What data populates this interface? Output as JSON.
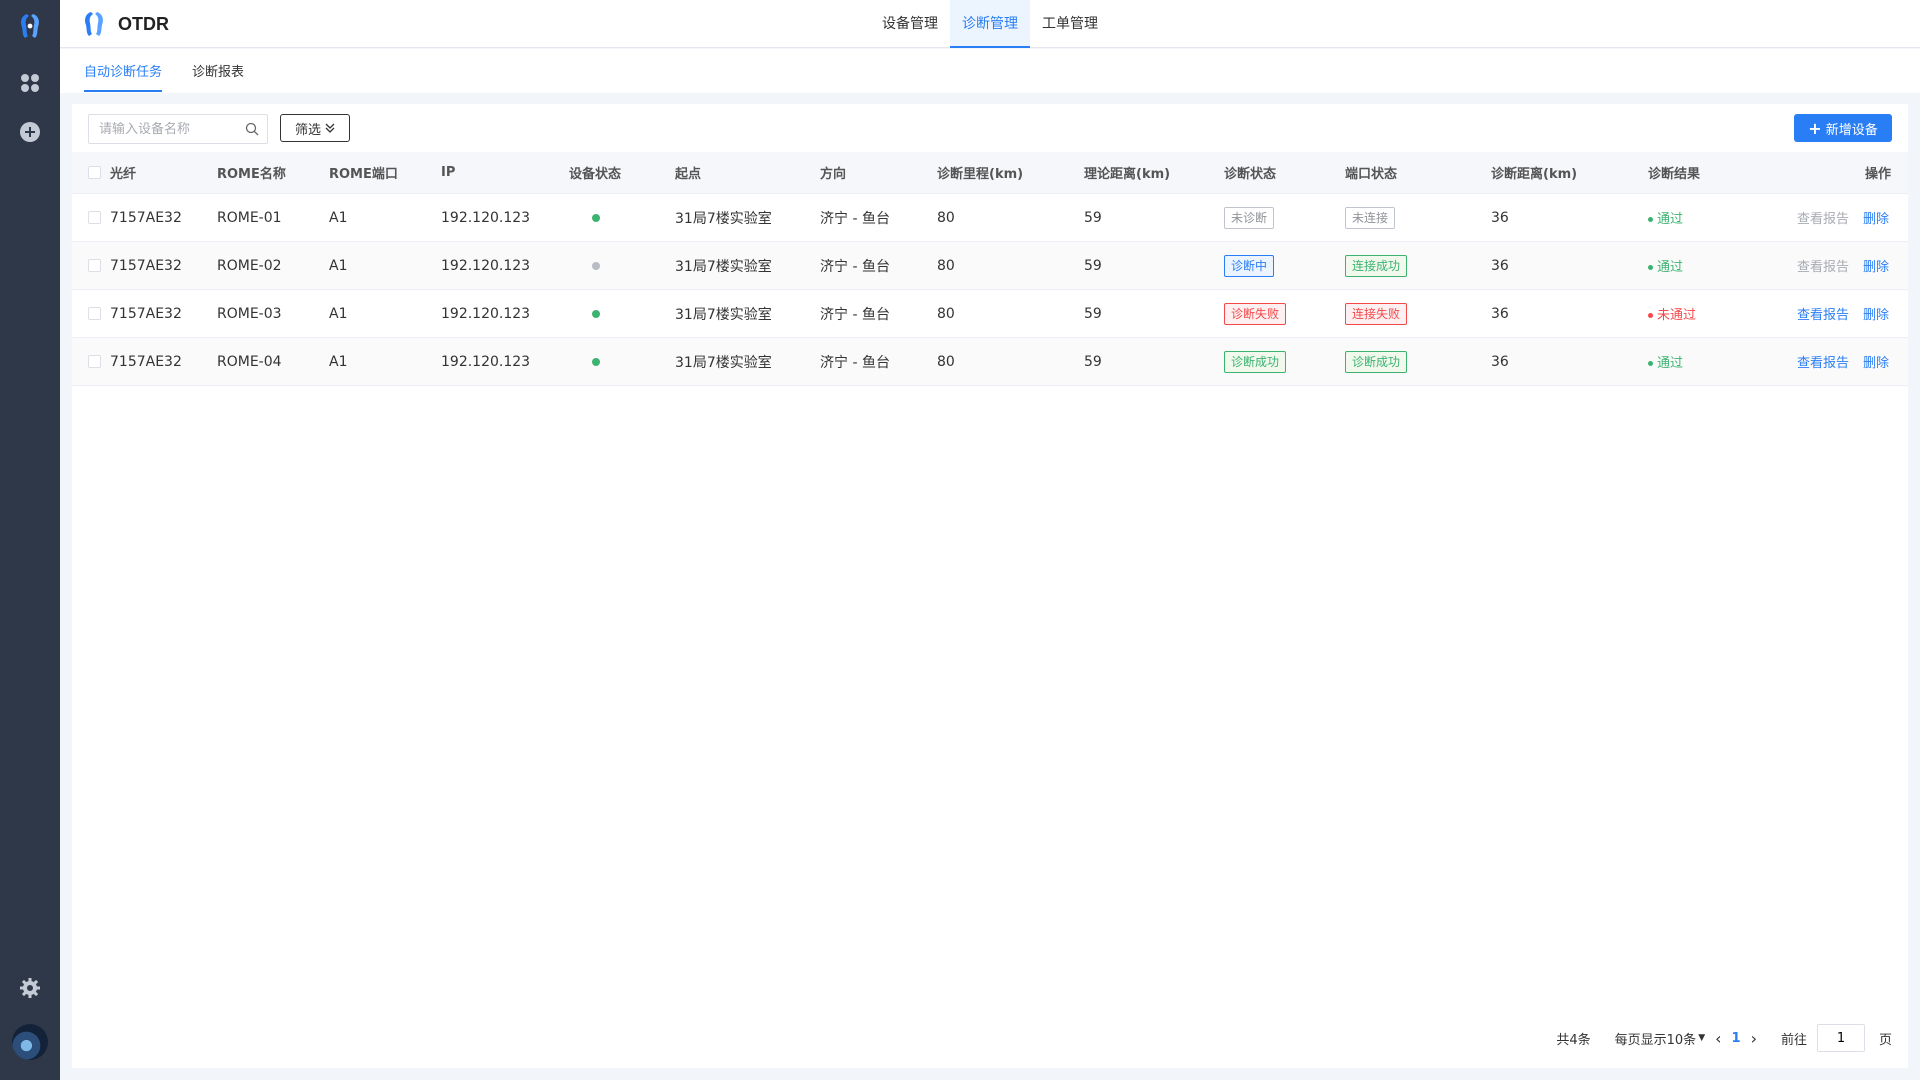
{
  "app": {
    "name": "OTDR",
    "brand_color": "#2a7ef5"
  },
  "rail": {
    "icons": [
      "logo-icon",
      "apps-grid-icon",
      "add-circle-icon",
      "settings-gear-icon",
      "user-avatar"
    ]
  },
  "top_tabs": [
    {
      "label": "设备管理",
      "active": false
    },
    {
      "label": "诊断管理",
      "active": true
    },
    {
      "label": "工单管理",
      "active": false
    }
  ],
  "sub_tabs": [
    {
      "label": "自动诊断任务",
      "active": true
    },
    {
      "label": "诊断报表",
      "active": false
    }
  ],
  "toolbar": {
    "search_placeholder": "请输入设备名称",
    "filter_label": "筛选",
    "add_label": "新增设备"
  },
  "table": {
    "columns": [
      "光纤",
      "ROME名称",
      "ROME端口",
      "IP",
      "设备状态",
      "起点",
      "方向",
      "诊断里程(km)",
      "理论距离(km)",
      "诊断状态",
      "端口状态",
      "诊断距离(km)",
      "诊断结果",
      "操作"
    ],
    "rows": [
      {
        "fiber": "7157AE32",
        "rome": "ROME-01",
        "port": "A1",
        "ip": "192.120.123",
        "device_status": "online",
        "start": "31局7楼实验室",
        "direction": "济宁 - 鱼台",
        "mileage": "80",
        "theory": "59",
        "diag_status": "未诊断",
        "diag_tag": "gray",
        "port_status": "未连接",
        "port_tag": "gray",
        "diag_dist": "36",
        "result": "通过",
        "result_type": "pass",
        "view": "查看报告",
        "view_enabled": false,
        "del": "删除"
      },
      {
        "fiber": "7157AE32",
        "rome": "ROME-02",
        "port": "A1",
        "ip": "192.120.123",
        "device_status": "offline",
        "start": "31局7楼实验室",
        "direction": "济宁 - 鱼台",
        "mileage": "80",
        "theory": "59",
        "diag_status": "诊断中",
        "diag_tag": "blue",
        "port_status": "连接成功",
        "port_tag": "green",
        "diag_dist": "36",
        "result": "通过",
        "result_type": "pass",
        "view": "查看报告",
        "view_enabled": false,
        "del": "删除"
      },
      {
        "fiber": "7157AE32",
        "rome": "ROME-03",
        "port": "A1",
        "ip": "192.120.123",
        "device_status": "online",
        "start": "31局7楼实验室",
        "direction": "济宁 - 鱼台",
        "mileage": "80",
        "theory": "59",
        "diag_status": "诊断失败",
        "diag_tag": "red",
        "port_status": "连接失败",
        "port_tag": "red",
        "diag_dist": "36",
        "result": "未通过",
        "result_type": "fail",
        "view": "查看报告",
        "view_enabled": true,
        "del": "删除"
      },
      {
        "fiber": "7157AE32",
        "rome": "ROME-04",
        "port": "A1",
        "ip": "192.120.123",
        "device_status": "online",
        "start": "31局7楼实验室",
        "direction": "济宁 - 鱼台",
        "mileage": "80",
        "theory": "59",
        "diag_status": "诊断成功",
        "diag_tag": "green",
        "port_status": "诊断成功",
        "port_tag": "green",
        "diag_dist": "36",
        "result": "通过",
        "result_type": "pass",
        "view": "查看报告",
        "view_enabled": true,
        "del": "删除"
      }
    ],
    "status_colors": {
      "online": "#3cb371",
      "offline": "#b9bcc4"
    }
  },
  "pagination": {
    "total": "共4条",
    "page_size": "每页显示10条",
    "current": "1",
    "goto_prefix": "前往",
    "goto_value": "1",
    "goto_suffix": "页"
  }
}
